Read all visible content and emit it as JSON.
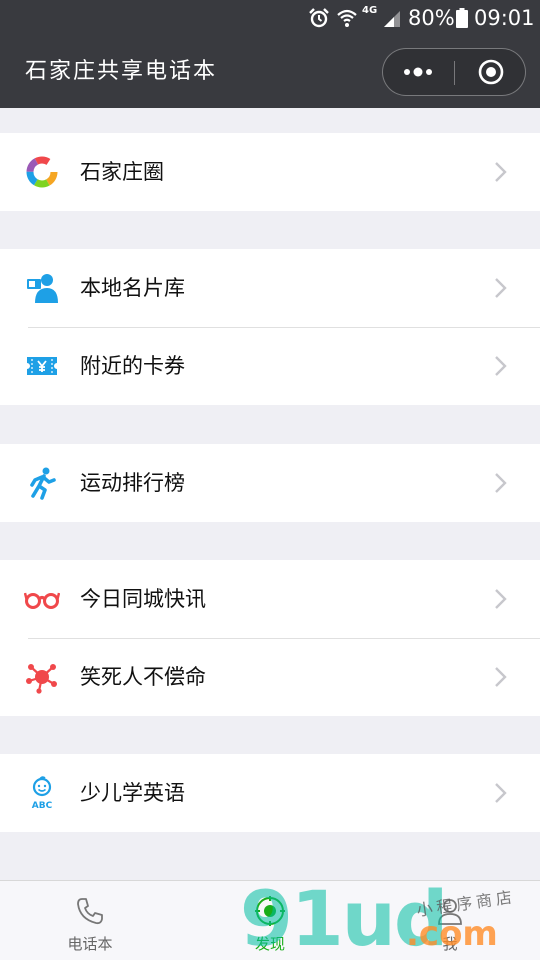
{
  "status_bar": {
    "battery_percent": "80%",
    "time": "09:01",
    "network": "4G"
  },
  "nav": {
    "title": "石家庄共享电话本"
  },
  "groups": [
    {
      "items": [
        {
          "label": "石家庄圈",
          "icon": "moments-ring-icon"
        }
      ]
    },
    {
      "items": [
        {
          "label": "本地名片库",
          "icon": "business-card-icon"
        },
        {
          "label": "附近的卡券",
          "icon": "coupon-icon"
        }
      ]
    },
    {
      "items": [
        {
          "label": "运动排行榜",
          "icon": "running-man-icon"
        }
      ]
    },
    {
      "items": [
        {
          "label": "今日同城快讯",
          "icon": "glasses-icon"
        },
        {
          "label": "笑死人不偿命",
          "icon": "molecule-icon"
        }
      ]
    },
    {
      "items": [
        {
          "label": "少儿学英语",
          "icon": "kid-abc-icon"
        }
      ]
    }
  ],
  "tabbar": {
    "tabs": [
      {
        "label": "电话本",
        "icon": "phone-icon"
      },
      {
        "label": "发现",
        "icon": "compass-icon"
      },
      {
        "label": "我",
        "icon": "person-icon"
      }
    ]
  },
  "watermark": {
    "brand": "91ud",
    "suffix": ".com",
    "handwritten": "小程序商店"
  },
  "colors": {
    "nav_bg": "#393a3f",
    "page_bg": "#efeff4",
    "active_tab": "#1aad19",
    "icon_blue": "#1ea0e6",
    "icon_red": "#f0484b"
  }
}
